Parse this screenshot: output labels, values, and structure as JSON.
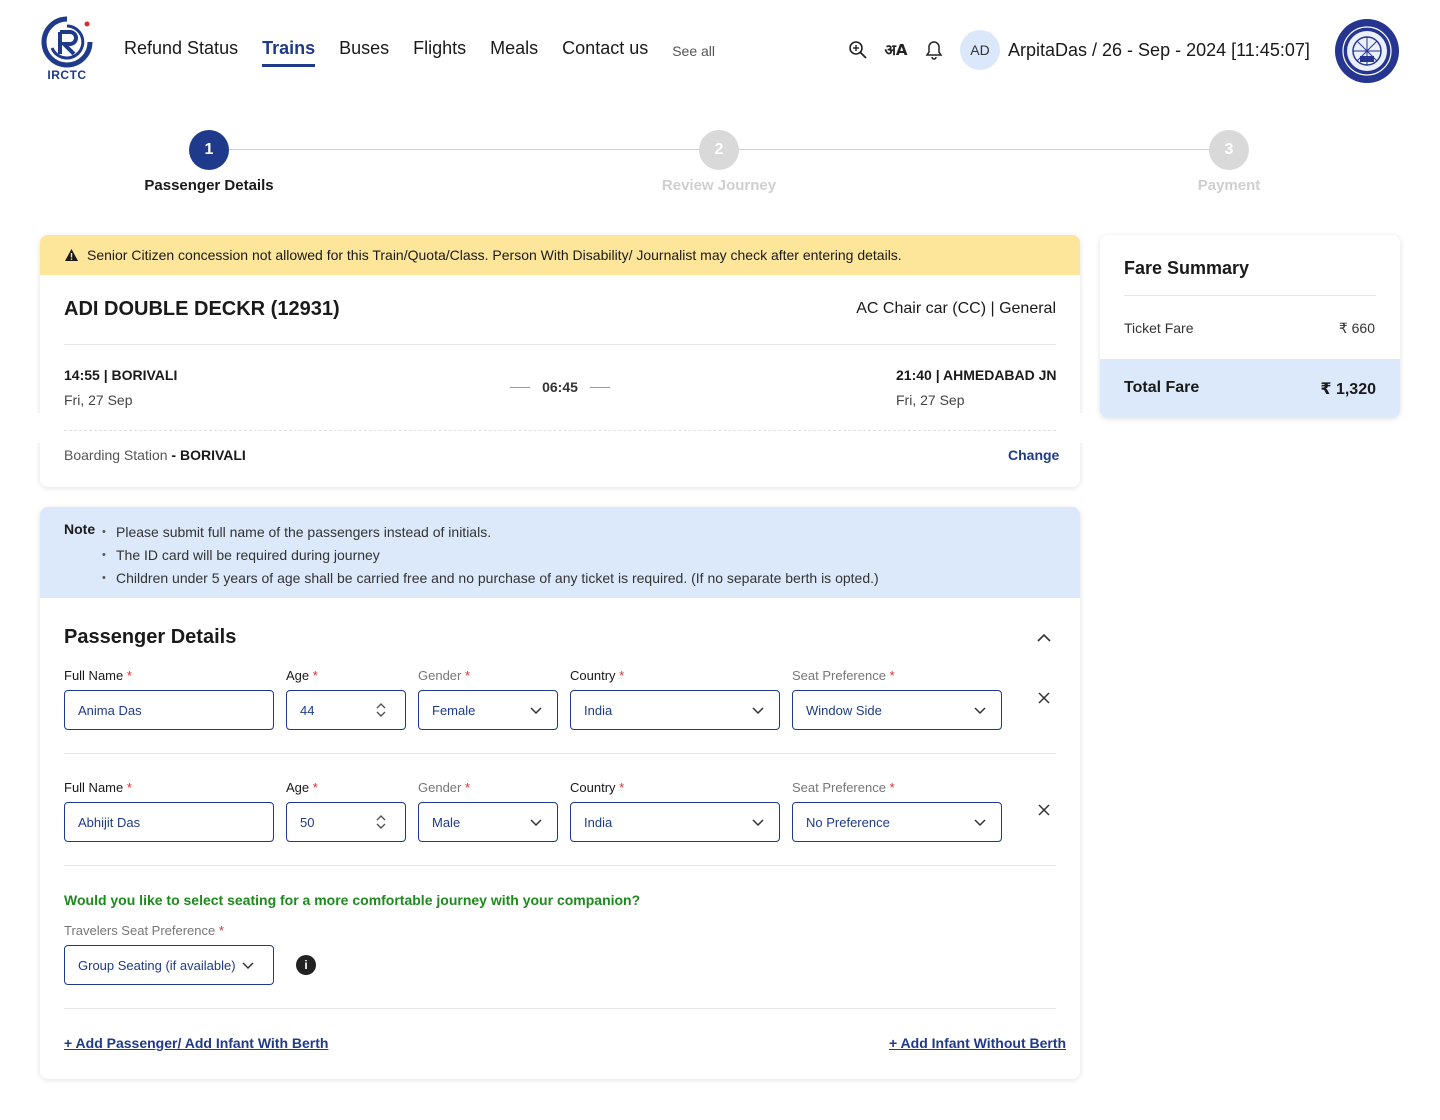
{
  "brand": {
    "logo_text": "IRCTC"
  },
  "nav": {
    "items": [
      "Refund Status",
      "Trains",
      "Buses",
      "Flights",
      "Meals",
      "Contact us"
    ],
    "active": "Trains",
    "see_all": "See all"
  },
  "header": {
    "icons": [
      "search-icon",
      "translate-icon",
      "bell-icon"
    ],
    "translate_glyph": "अA",
    "avatar_initials": "AD",
    "user_line": "ArpitaDas / 26 - Sep - 2024 [11:45:07]"
  },
  "stepper": {
    "steps": [
      {
        "number": "1",
        "label": "Passenger Details",
        "state": "active"
      },
      {
        "number": "2",
        "label": "Review Journey",
        "state": "inactive"
      },
      {
        "number": "3",
        "label": "Payment",
        "state": "inactive"
      }
    ]
  },
  "alert": {
    "text": "Senior Citizen concession not allowed for this Train/Quota/Class. Person With Disability/ Journalist may check after entering details."
  },
  "train": {
    "name": "ADI DOUBLE DECKR (12931)",
    "class_quota": "AC Chair car (CC) | General",
    "departure_time_station": "14:55 | BORIVALI",
    "departure_date": "Fri, 27 Sep",
    "duration": "06:45",
    "arrival_time_station": "21:40 | AHMEDABAD JN",
    "arrival_date": "Fri, 27 Sep",
    "boarding_label": "Boarding Station",
    "boarding_station": "- BORIVALI",
    "change_label": "Change"
  },
  "note": {
    "title": "Note",
    "items": [
      "Please submit full name of the passengers instead of initials.",
      "The ID card will be required during journey",
      "Children under 5 years of age shall be carried free and no purchase of any ticket is required. (If no separate berth is opted.)"
    ]
  },
  "passengers_section": {
    "title": "Passenger Details",
    "labels": {
      "full_name": "Full Name",
      "age": "Age",
      "gender": "Gender",
      "country": "Country",
      "seat_preference": "Seat Preference",
      "required": "*"
    },
    "passengers": [
      {
        "full_name": "Anima Das",
        "age": "44",
        "gender": "Female",
        "country": "India",
        "seat_preference": "Window Side"
      },
      {
        "full_name": "Abhijit Das",
        "age": "50",
        "gender": "Male",
        "country": "India",
        "seat_preference": "No Preference"
      }
    ],
    "companion_question": "Would you like to select seating for a more comfortable journey with your companion?",
    "travelers_seat_label": "Travelers Seat Preference",
    "travelers_seat_value": "Group Seating (if available)",
    "info_glyph": "i",
    "add_passenger_link": "+ Add Passenger/ Add Infant With Berth",
    "add_infant_link": "+ Add Infant Without Berth"
  },
  "fare_summary": {
    "title": "Fare Summary",
    "ticket_fare_label": "Ticket Fare",
    "ticket_fare_value": "₹ 660",
    "total_label": "Total Fare",
    "total_value": "₹ 1,320"
  },
  "colors": {
    "primary": "#1f3a8a",
    "alert_bg": "#fde59a",
    "note_bg": "#dce9fb",
    "success_text": "#1e8a1e",
    "step_inactive": "#d9d9d9"
  }
}
